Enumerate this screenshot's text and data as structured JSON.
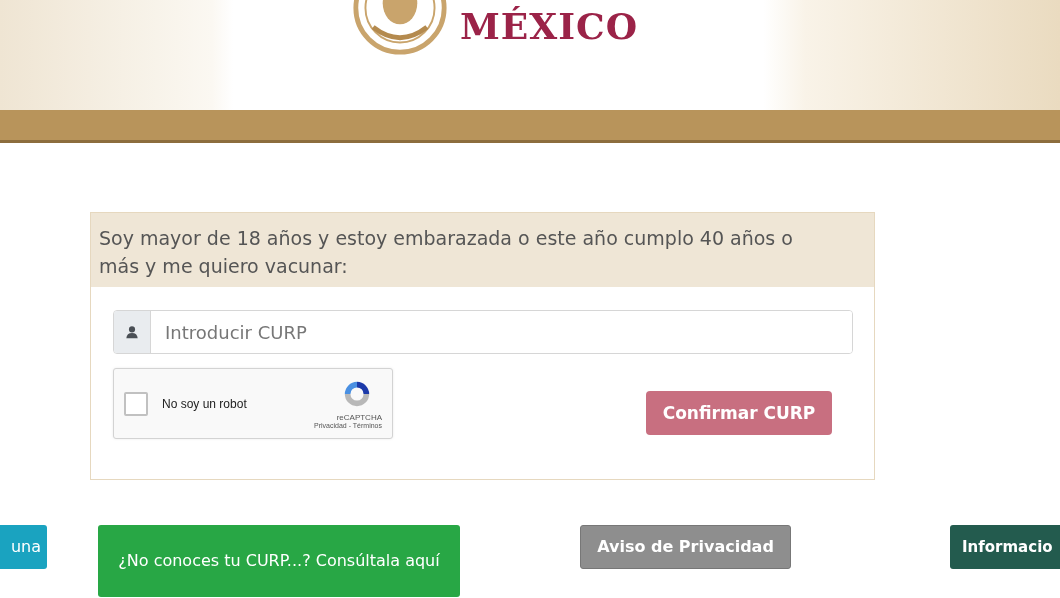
{
  "header": {
    "title": "MÉXICO"
  },
  "form": {
    "heading": "Soy mayor de 18 años y estoy embarazada o este año cumplo 40 años o más y me quiero vacunar:",
    "curp_field": {
      "placeholder": "Introducir CURP"
    },
    "captcha": {
      "label": "No soy un robot",
      "checked": false,
      "brand": "reCAPTCHA",
      "links": "Privacidad - Términos"
    },
    "confirm_button": {
      "label": "Confirmar CURP",
      "disabled": true
    }
  },
  "footer_buttons": [
    {
      "label": "una",
      "kind": "teal"
    },
    {
      "label": "¿No conoces tu CURP...? Consúltala aquí",
      "kind": "green"
    },
    {
      "label": "Aviso de Privacidad",
      "kind": "grey"
    },
    {
      "label": "Informacio",
      "kind": "dark"
    }
  ]
}
